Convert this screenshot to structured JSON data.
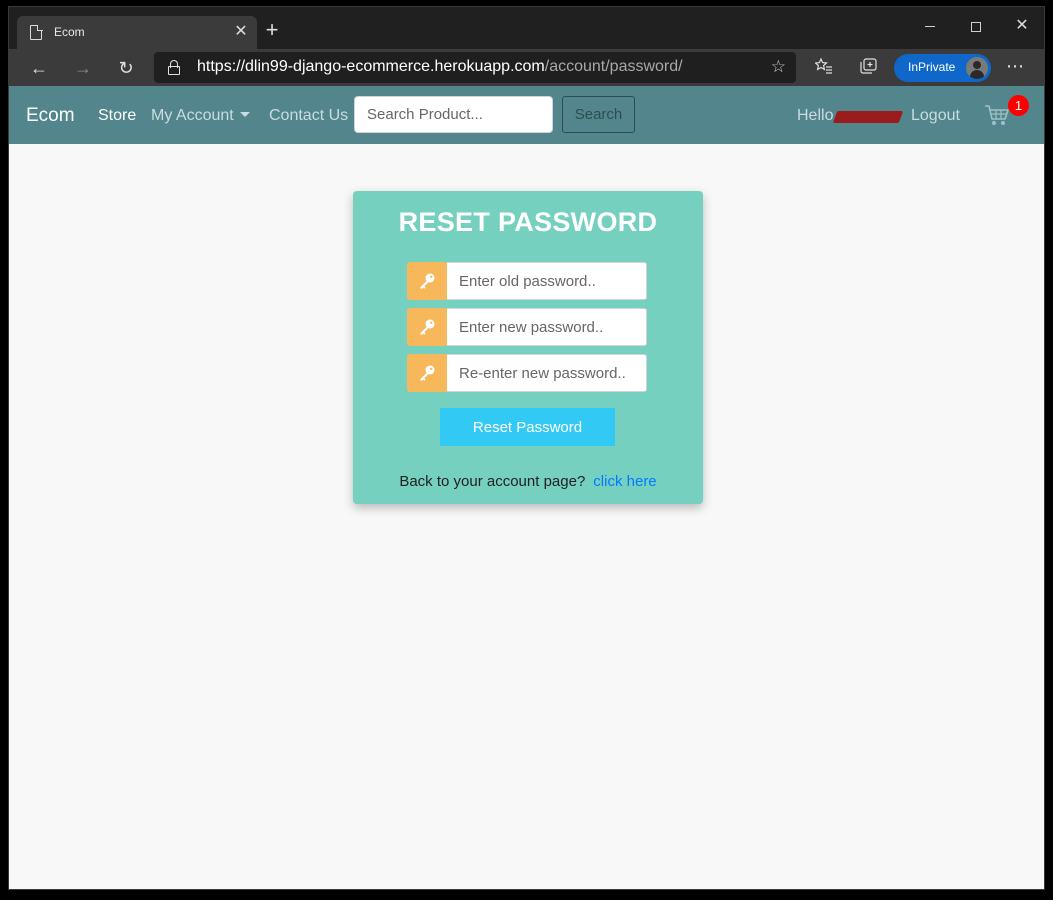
{
  "browser": {
    "tab_title": "Ecom",
    "url_host": "https://dlin99-django-ecommerce.herokuapp.com",
    "url_path": "/account/password/",
    "inprivate_label": "InPrivate"
  },
  "navbar": {
    "brand": "Ecom",
    "store": "Store",
    "my_account": "My Account",
    "contact": "Contact Us",
    "search_placeholder": "Search Product...",
    "search_button": "Search",
    "hello": "Hello",
    "logout": "Logout",
    "cart_count": "1",
    "colors": {
      "navbar_bg": "#52858c",
      "badge": "#ff0000"
    }
  },
  "form": {
    "title": "RESET PASSWORD",
    "old_password_placeholder": "Enter old password..",
    "new_password_placeholder": "Enter new password..",
    "confirm_password_placeholder": "Re-enter new password..",
    "submit": "Reset Password",
    "back_text": "Back to your account page?",
    "back_link": "click here",
    "colors": {
      "card_bg": "#76d0c0",
      "addon_bg": "#f6b85a",
      "button_bg": "#33c9f5",
      "link": "#007bff"
    },
    "icons": [
      "key-icon",
      "key-icon",
      "key-icon"
    ]
  }
}
